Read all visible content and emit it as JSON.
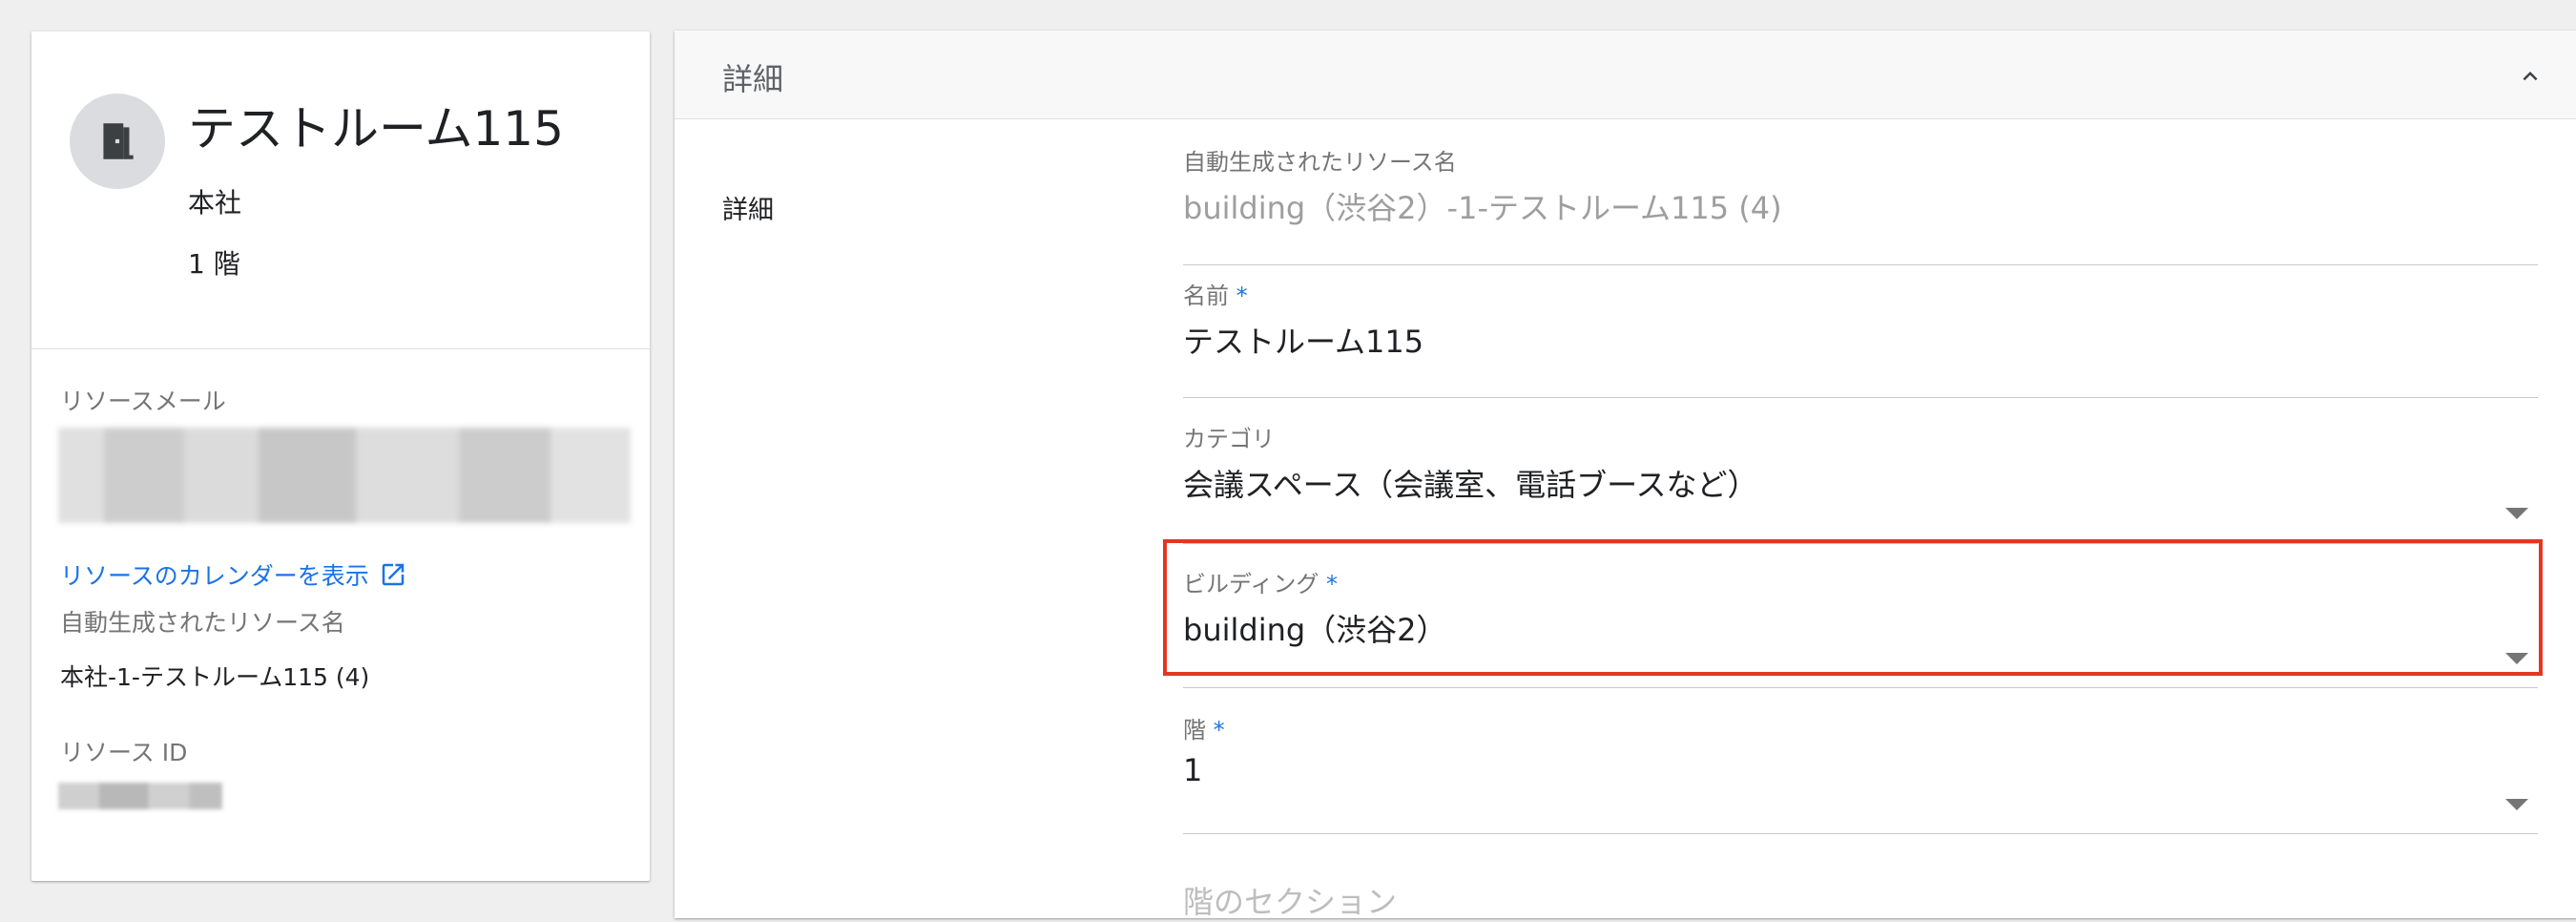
{
  "resource": {
    "title": "テストルーム115",
    "building": "本社",
    "floor": "1 階"
  },
  "left_panel": {
    "resource_email_label": "リソースメール",
    "calendar_link": "リソースのカレンダーを表示",
    "auto_name_label": "自動生成されたリソース名",
    "auto_name_value": "本社-1-テストルーム115 (4)",
    "resource_id_label": "リソース ID"
  },
  "details": {
    "header_title": "詳細",
    "section_label": "詳細",
    "fields": {
      "auto_name": {
        "label": "自動生成されたリソース名",
        "value": "building（渋谷2）-1-テストルーム115 (4)"
      },
      "name": {
        "label": "名前",
        "required_mark": "*",
        "value": "テストルーム115"
      },
      "category": {
        "label": "カテゴリ",
        "value": "会議スペース（会議室、電話ブースなど）"
      },
      "building": {
        "label": "ビルディング",
        "required_mark": "*",
        "value": "building（渋谷2）"
      },
      "floor": {
        "label": "階",
        "required_mark": "*",
        "value": "1"
      },
      "floor_section": {
        "label": "階のセクション"
      }
    }
  },
  "colors": {
    "link": "#1a73e8",
    "highlight": "#e53524"
  }
}
